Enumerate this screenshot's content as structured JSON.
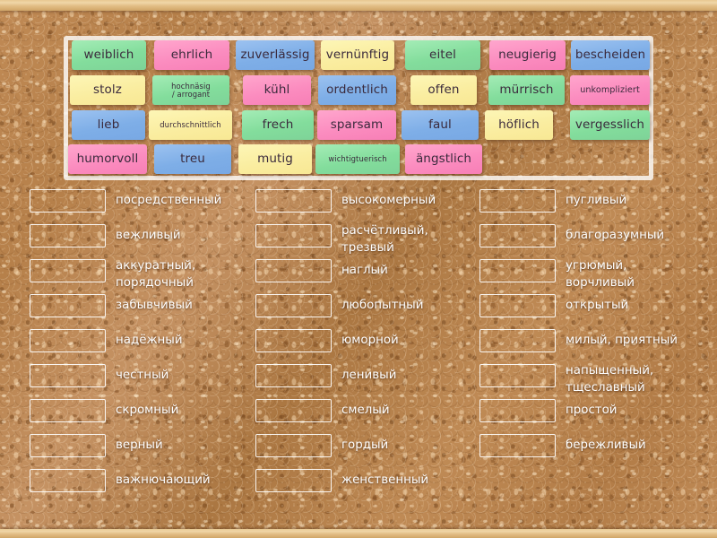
{
  "board": {
    "type": "cork-board-matchup-activity",
    "background_color": "#b8834f",
    "frame_color": "#ffffff"
  },
  "tray": {
    "label": "word-tile-tray",
    "tiles": [
      {
        "text": "weiblich",
        "color": "green",
        "hex": "#83dd9c",
        "row": 1,
        "col": 1,
        "size": "normal"
      },
      {
        "text": "ehrlich",
        "color": "pink",
        "hex": "#fb8cbf",
        "row": 1,
        "col": 2,
        "size": "normal"
      },
      {
        "text": "zuverlässig",
        "color": "blue",
        "hex": "#7eaee7",
        "row": 1,
        "col": 3,
        "size": "normal"
      },
      {
        "text": "vernünftig",
        "color": "yellow",
        "hex": "#faeda0",
        "row": 1,
        "col": 4,
        "size": "normal"
      },
      {
        "text": "eitel",
        "color": "green",
        "hex": "#83dd9c",
        "row": 1,
        "col": 5,
        "size": "normal"
      },
      {
        "text": "neugierig",
        "color": "pink",
        "hex": "#fb8cbf",
        "row": 1,
        "col": 6,
        "size": "normal"
      },
      {
        "text": "bescheiden",
        "color": "blue",
        "hex": "#7eaee7",
        "row": 1,
        "col": 7,
        "size": "normal"
      },
      {
        "text": "stolz",
        "color": "yellow",
        "hex": "#faeda0",
        "row": 2,
        "col": 1,
        "size": "normal"
      },
      {
        "text": "hochnäsig\n/ arrogant",
        "color": "green",
        "hex": "#83dd9c",
        "row": 2,
        "col": 2,
        "size": "smaller"
      },
      {
        "text": "kühl",
        "color": "pink",
        "hex": "#fb8cbf",
        "row": 2,
        "col": 3,
        "size": "normal"
      },
      {
        "text": "ordentlich",
        "color": "blue",
        "hex": "#7eaee7",
        "row": 2,
        "col": 4,
        "size": "normal"
      },
      {
        "text": "offen",
        "color": "yellow",
        "hex": "#faeda0",
        "row": 2,
        "col": 5,
        "size": "normal"
      },
      {
        "text": "mürrisch",
        "color": "green",
        "hex": "#83dd9c",
        "row": 2,
        "col": 6,
        "size": "normal"
      },
      {
        "text": "unkompliziert",
        "color": "pink",
        "hex": "#fb8cbf",
        "row": 2,
        "col": 7,
        "size": "small"
      },
      {
        "text": "lieb",
        "color": "blue",
        "hex": "#7eaee7",
        "row": 3,
        "col": 1,
        "size": "normal"
      },
      {
        "text": "durchschnittlich",
        "color": "yellow",
        "hex": "#faeda0",
        "row": 3,
        "col": 2,
        "size": "smaller"
      },
      {
        "text": "frech",
        "color": "green",
        "hex": "#83dd9c",
        "row": 3,
        "col": 3,
        "size": "normal"
      },
      {
        "text": "sparsam",
        "color": "pink",
        "hex": "#fb8cbf",
        "row": 3,
        "col": 4,
        "size": "normal"
      },
      {
        "text": "faul",
        "color": "blue",
        "hex": "#7eaee7",
        "row": 3,
        "col": 5,
        "size": "normal"
      },
      {
        "text": "höflich",
        "color": "yellow",
        "hex": "#faeda0",
        "row": 3,
        "col": 6,
        "size": "normal"
      },
      {
        "text": "vergesslich",
        "color": "green",
        "hex": "#83dd9c",
        "row": 3,
        "col": 7,
        "size": "normal"
      },
      {
        "text": "humorvoll",
        "color": "pink",
        "hex": "#fb8cbf",
        "row": 4,
        "col": 1,
        "size": "normal"
      },
      {
        "text": "treu",
        "color": "blue",
        "hex": "#7eaee7",
        "row": 4,
        "col": 2,
        "size": "normal"
      },
      {
        "text": "mutig",
        "color": "yellow",
        "hex": "#faeda0",
        "row": 4,
        "col": 3,
        "size": "normal"
      },
      {
        "text": "wichtigtuerisch",
        "color": "green",
        "hex": "#83dd9c",
        "row": 4,
        "col": 4,
        "size": "smaller"
      },
      {
        "text": "ängstlich",
        "color": "pink",
        "hex": "#fb8cbf",
        "row": 4,
        "col": 5,
        "size": "normal"
      }
    ]
  },
  "answers": {
    "column1": [
      "посредственный",
      "вежливый",
      "аккуратный,\nпорядочный",
      "забывчивый",
      "надёжный",
      "честный",
      "скромный",
      "верный",
      "важнючающий"
    ],
    "column2": [
      "высокомерный",
      "расчётливый,\nтрезвый",
      "наглый",
      "любопытный",
      "юморной",
      "ленивый",
      "смелый",
      "гордый",
      "женственный"
    ],
    "column3": [
      "пугливый",
      "благоразумный",
      "угрюмый,\nворчливый",
      "открытый",
      "милый, приятный",
      "напыщенный,\nтщеславный",
      "простой",
      "бережливый"
    ]
  }
}
